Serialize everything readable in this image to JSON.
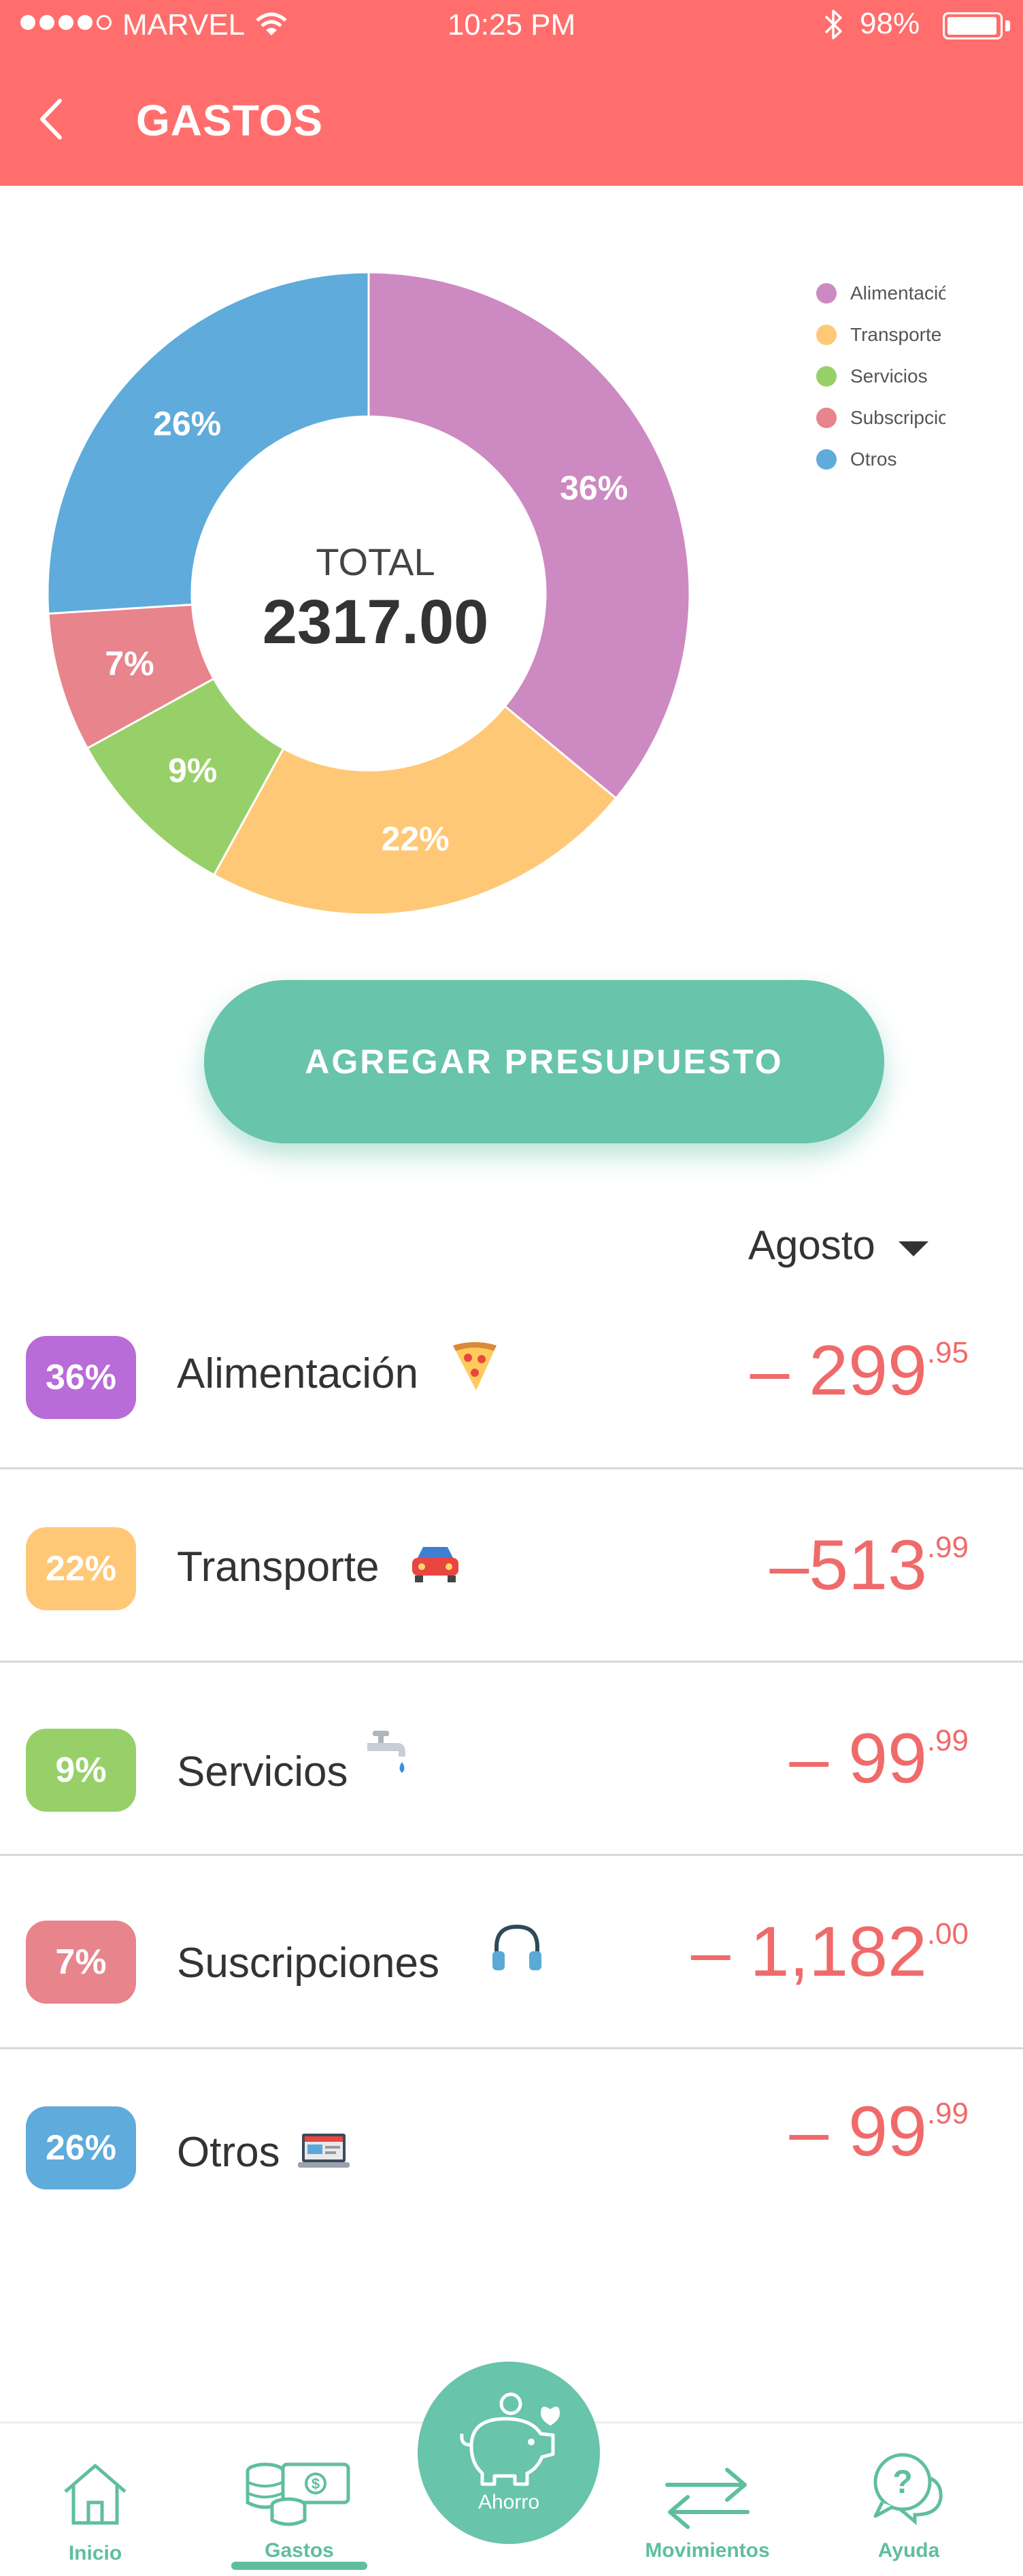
{
  "status_bar": {
    "carrier": "MARVEL",
    "time": "10:25 PM",
    "battery": "98%"
  },
  "header": {
    "title": "GASTOS"
  },
  "chart_data": {
    "type": "pie",
    "center_label": "TOTAL",
    "center_value": "2317.00",
    "legend_position": "top-right",
    "slices": [
      {
        "name": "Alimentación",
        "value": 36,
        "label": "36%",
        "color": "#cd89c1"
      },
      {
        "name": "Transporte",
        "value": 22,
        "label": "22%",
        "color": "#ffc877"
      },
      {
        "name": "Servicios",
        "value": 9,
        "label": "9%",
        "color": "#97d068"
      },
      {
        "name": "Subscripciones",
        "value": 7,
        "label": "7%",
        "color": "#e8848c"
      },
      {
        "name": "Otros",
        "value": 26,
        "label": "26%",
        "color": "#5fabdc"
      }
    ]
  },
  "actions": {
    "add_budget": "AGREGAR PRESUPUESTO"
  },
  "month_selector": {
    "value": "Agosto"
  },
  "expenses": [
    {
      "percent": "36%",
      "name": "Alimentación",
      "icon": "pizza-icon",
      "amount": "– 299",
      "cents": ".95",
      "color": "#b96bd8"
    },
    {
      "percent": "22%",
      "name": "Transporte",
      "icon": "car-icon",
      "amount": "–513",
      "cents": ".99",
      "color": "#ffc877"
    },
    {
      "percent": "9%",
      "name": "Servicios",
      "icon": "faucet-icon",
      "amount": "– 99",
      "cents": ".99",
      "color": "#97d068"
    },
    {
      "percent": "7%",
      "name": "Suscripciones",
      "icon": "headphones-icon",
      "amount": "– 1,182",
      "cents": ".00",
      "color": "#e8848c"
    },
    {
      "percent": "26%",
      "name": "Otros",
      "icon": "laptop-icon",
      "amount": "– 99",
      "cents": ".99",
      "color": "#5fabdc"
    }
  ],
  "tabbar": {
    "inicio": "Inicio",
    "gastos": "Gastos",
    "ahorro": "Ahorro",
    "movimientos": "Movimientos",
    "ayuda": "Ayuda"
  }
}
